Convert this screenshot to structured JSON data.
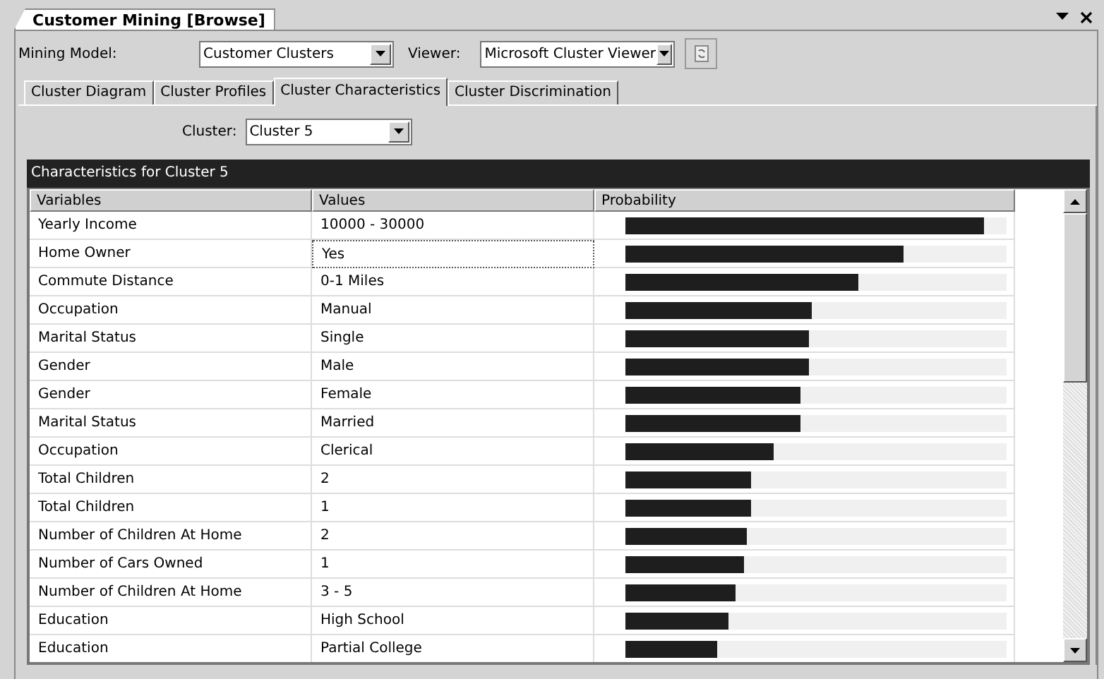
{
  "document_tab": {
    "title": "Customer Mining [Browse]"
  },
  "toolbar": {
    "mining_model_label": "Mining Model:",
    "mining_model": "Customer Clusters",
    "viewer_label": "Viewer:",
    "viewer": "Microsoft Cluster Viewer"
  },
  "tabs": [
    {
      "label": "Cluster Diagram",
      "selected": false
    },
    {
      "label": "Cluster Profiles",
      "selected": false
    },
    {
      "label": "Cluster Characteristics",
      "selected": true
    },
    {
      "label": "Cluster Discrimination",
      "selected": false
    }
  ],
  "cluster_selector": {
    "label": "Cluster:",
    "value": "Cluster 5"
  },
  "table": {
    "title": "Characteristics for Cluster 5",
    "columns": [
      "Variables",
      "Values",
      "Probability"
    ],
    "rows": [
      {
        "variable": "Yearly Income",
        "value": "10000 - 30000",
        "level": 0.94,
        "selected": false
      },
      {
        "variable": "Home Owner",
        "value": "Yes",
        "level": 0.73,
        "selected": true
      },
      {
        "variable": "Commute Distance",
        "value": "0-1 Miles",
        "level": 0.61,
        "selected": false
      },
      {
        "variable": "Occupation",
        "value": "Manual",
        "level": 0.49,
        "selected": false
      },
      {
        "variable": "Marital Status",
        "value": "Single",
        "level": 0.48,
        "selected": false
      },
      {
        "variable": "Gender",
        "value": "Male",
        "level": 0.48,
        "selected": false
      },
      {
        "variable": "Gender",
        "value": "Female",
        "level": 0.46,
        "selected": false
      },
      {
        "variable": "Marital Status",
        "value": "Married",
        "level": 0.46,
        "selected": false
      },
      {
        "variable": "Occupation",
        "value": "Clerical",
        "level": 0.39,
        "selected": false
      },
      {
        "variable": "Total Children",
        "value": "2",
        "level": 0.33,
        "selected": false
      },
      {
        "variable": "Total Children",
        "value": "1",
        "level": 0.33,
        "selected": false
      },
      {
        "variable": "Number of Children At Home",
        "value": "2",
        "level": 0.32,
        "selected": false
      },
      {
        "variable": "Number of Cars Owned",
        "value": "1",
        "level": 0.31,
        "selected": false
      },
      {
        "variable": "Number of Children At Home",
        "value": "3 - 5",
        "level": 0.29,
        "selected": false
      },
      {
        "variable": "Education",
        "value": "High School",
        "level": 0.27,
        "selected": false
      },
      {
        "variable": "Education",
        "value": "Partial College",
        "level": 0.24,
        "selected": false
      }
    ]
  }
}
